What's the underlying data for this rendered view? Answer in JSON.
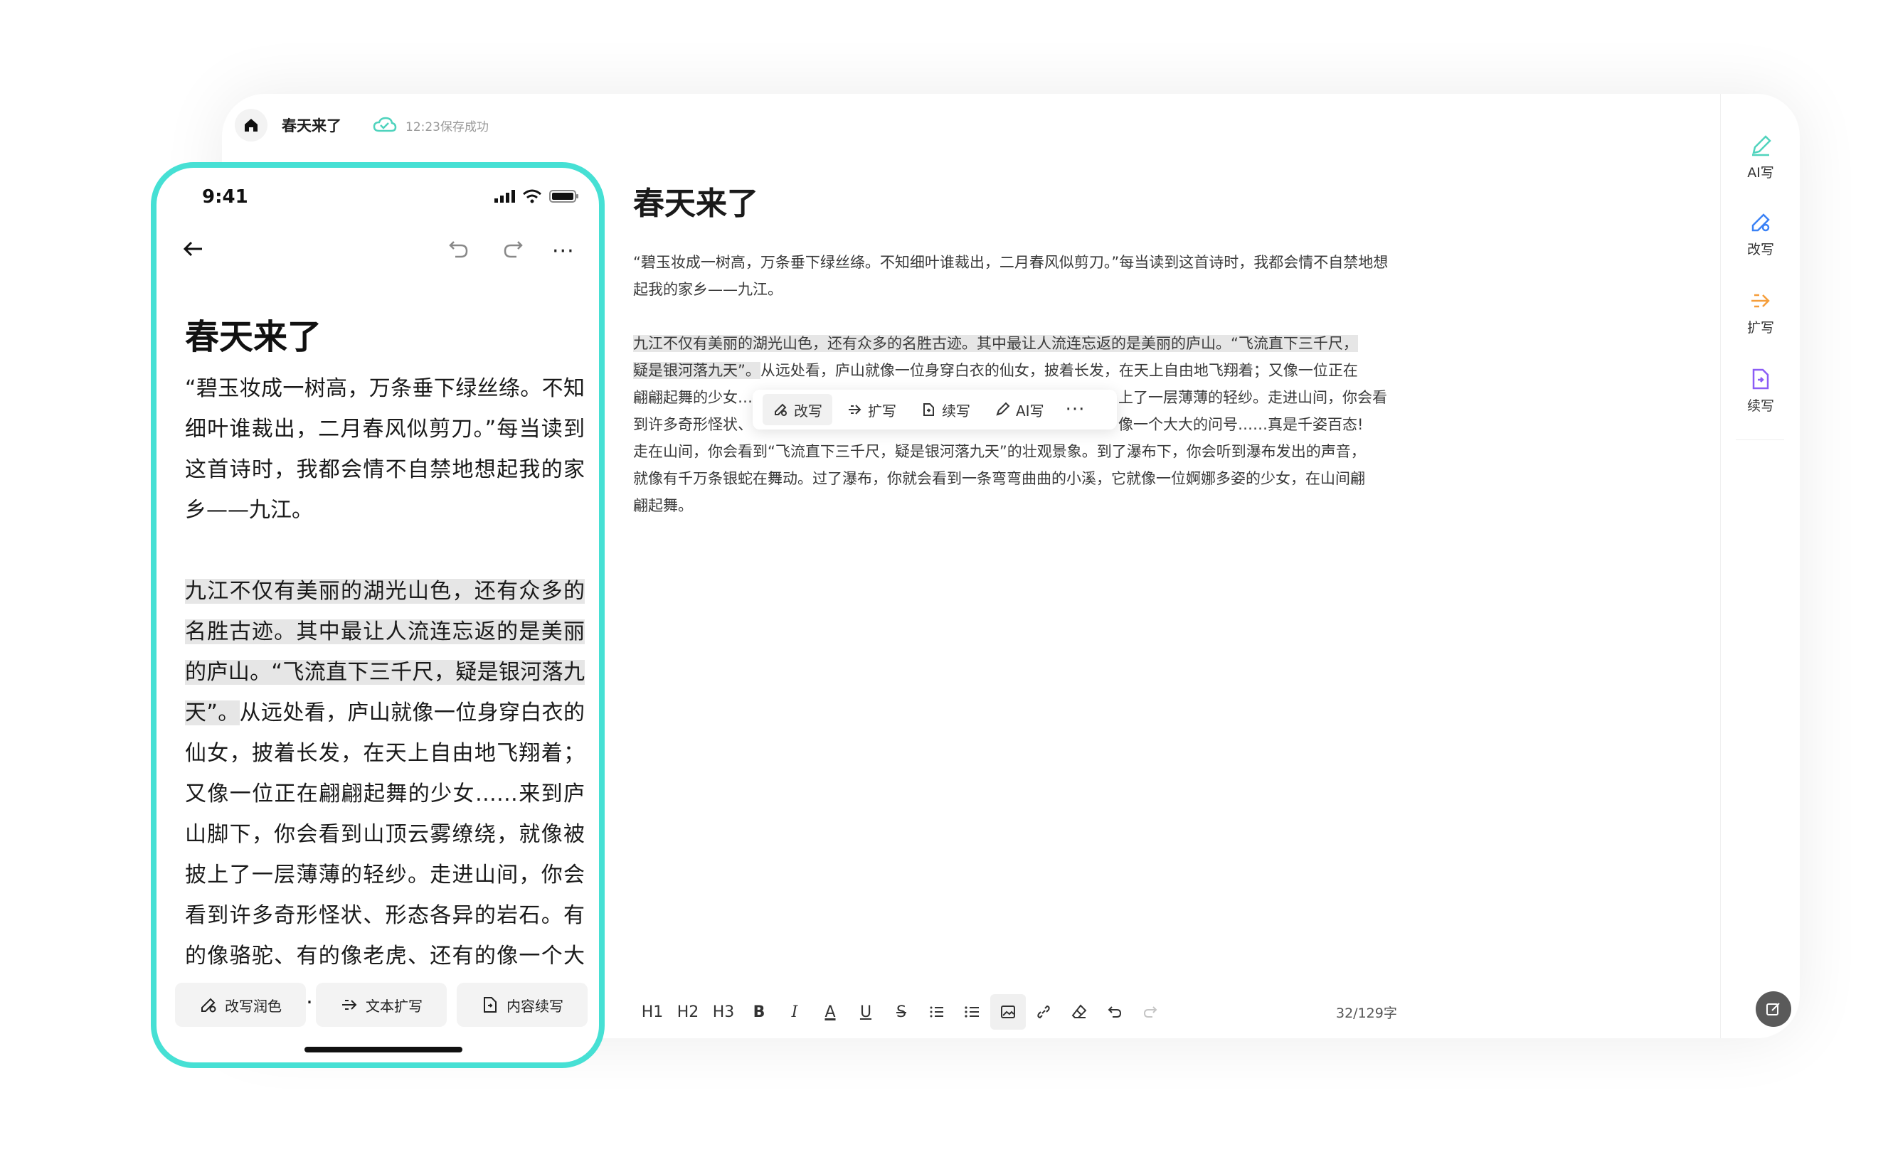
{
  "topbar": {
    "doc_title": "春天来了",
    "save_status": "12:23保存成功"
  },
  "editor": {
    "title": "春天来了",
    "para1": "“碧玉妆成一树高，万条垂下绿丝绦。不知细叶谁裁出，二月春风似剪刀。”每当读到这首诗时，我都会情不自禁地想起我的家乡——九江。",
    "para2_line1": "九江不仅有美丽的湖光山色，还有众多的名胜古迹。其中最让人流连忘返的是美丽的庐山。“飞流直下三千尺，",
    "para2_line2_hl": "疑是银河落九天”。",
    "para2_line2_rest": "从远处看，庐山就像一位身穿白衣的仙女，披着长发，在天上自由地飞翔着；又像一位正在",
    "para2_line3_start": "翩翩起舞的少女…",
    "para2_line3_end": "上了一层薄薄的轻纱。走进山间，你会看",
    "para2_line4_start": "到许多奇形怪状、",
    "para2_line4_end": "像一个大大的问号……真是千姿百态!",
    "para2_line5": "走在山间，你会看到“飞流直下三千尺，疑是银河落九天”的壮观景象。到了瀑布下，你会听到瀑布发出的声音，",
    "para2_line6": "就像有千万条银蛇在舞动。过了瀑布，你就会看到一条弯弯曲曲的小溪，它就像一位婀娜多姿的少女，在山间翩",
    "para2_line7": "翩起舞。"
  },
  "float_toolbar": {
    "rewrite": "改写",
    "expand": "扩写",
    "continue": "续写",
    "ai_write": "AI写",
    "more": "···"
  },
  "bottom_toolbar": {
    "h1": "H1",
    "h2": "H2",
    "h3": "H3",
    "bold": "B",
    "italic": "I",
    "color": "A",
    "underline": "U",
    "strike": "S"
  },
  "word_count": "32/129字",
  "right_panel": {
    "ai_write": "AI写",
    "rewrite": "改写",
    "expand": "扩写",
    "continue": "续写"
  },
  "phone": {
    "time": "9:41",
    "title": "春天来了",
    "para1": "“碧玉妆成一树高，万条垂下绿丝绦。不知细叶谁裁出，二月春风似剪刀。”每当读到这首诗时，我都会情不自禁地想起我的家乡——九江。",
    "para2_hl": "九江不仅有美丽的湖光山色，还有众多的名胜古迹。其中最让人流连忘返的是美丽的庐山。“飞流直下三千尺，疑是银河落九天”。",
    "para2_rest": "从远处看，庐山就像一位身穿白衣的仙女，披着长发，在天上自由地飞翔着；又像一位正在翩翩起舞的少女……来到庐山脚下，你会看到山顶云雾缭绕，就像被披上了一层薄薄的轻纱。走进山间，你会看到许多奇形怪状、形态各异的岩石。有的像骆驼、有的像老虎、还有的像一个大大的问号……",
    "btn_polish": "改写润色",
    "btn_expand": "文本扩写",
    "btn_continue": "内容续写"
  },
  "colors": {
    "phone_border": "#46e0d4",
    "accent_green": "#4fd3bd",
    "accent_blue": "#3b82f6",
    "accent_orange": "#f59e3b",
    "accent_purple": "#8b5cf6"
  }
}
